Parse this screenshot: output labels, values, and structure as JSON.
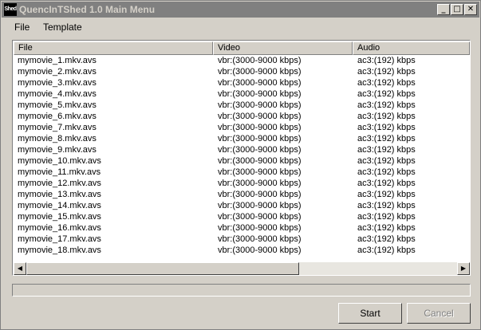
{
  "window": {
    "icon_text": "Shed",
    "title": "QuencInTShed 1.0 Main Menu",
    "controls": {
      "minimize": "_",
      "maximize": "□",
      "close": "✕"
    }
  },
  "menu": [
    "File",
    "Template"
  ],
  "table": {
    "columns": [
      "File",
      "Video",
      "Audio"
    ],
    "rows": [
      [
        "mymovie_1.mkv.avs",
        "vbr:(3000-9000 kbps)",
        "ac3:(192) kbps"
      ],
      [
        "mymovie_2.mkv.avs",
        "vbr:(3000-9000 kbps)",
        "ac3:(192) kbps"
      ],
      [
        "mymovie_3.mkv.avs",
        "vbr:(3000-9000 kbps)",
        "ac3:(192) kbps"
      ],
      [
        "mymovie_4.mkv.avs",
        "vbr:(3000-9000 kbps)",
        "ac3:(192) kbps"
      ],
      [
        "mymovie_5.mkv.avs",
        "vbr:(3000-9000 kbps)",
        "ac3:(192) kbps"
      ],
      [
        "mymovie_6.mkv.avs",
        "vbr:(3000-9000 kbps)",
        "ac3:(192) kbps"
      ],
      [
        "mymovie_7.mkv.avs",
        "vbr:(3000-9000 kbps)",
        "ac3:(192) kbps"
      ],
      [
        "mymovie_8.mkv.avs",
        "vbr:(3000-9000 kbps)",
        "ac3:(192) kbps"
      ],
      [
        "mymovie_9.mkv.avs",
        "vbr:(3000-9000 kbps)",
        "ac3:(192) kbps"
      ],
      [
        "mymovie_10.mkv.avs",
        "vbr:(3000-9000 kbps)",
        "ac3:(192) kbps"
      ],
      [
        "mymovie_11.mkv.avs",
        "vbr:(3000-9000 kbps)",
        "ac3:(192) kbps"
      ],
      [
        "mymovie_12.mkv.avs",
        "vbr:(3000-9000 kbps)",
        "ac3:(192) kbps"
      ],
      [
        "mymovie_13.mkv.avs",
        "vbr:(3000-9000 kbps)",
        "ac3:(192) kbps"
      ],
      [
        "mymovie_14.mkv.avs",
        "vbr:(3000-9000 kbps)",
        "ac3:(192) kbps"
      ],
      [
        "mymovie_15.mkv.avs",
        "vbr:(3000-9000 kbps)",
        "ac3:(192) kbps"
      ],
      [
        "mymovie_16.mkv.avs",
        "vbr:(3000-9000 kbps)",
        "ac3:(192) kbps"
      ],
      [
        "mymovie_17.mkv.avs",
        "vbr:(3000-9000 kbps)",
        "ac3:(192) kbps"
      ],
      [
        "mymovie_18.mkv.avs",
        "vbr:(3000-9000 kbps)",
        "ac3:(192) kbps"
      ]
    ]
  },
  "scrollbar": {
    "left_arrow": "◀",
    "right_arrow": "▶"
  },
  "progress": {
    "value": 0
  },
  "buttons": {
    "start": "Start",
    "cancel": "Cancel"
  },
  "colors": {
    "face": "#d4d0c8",
    "titlebar_inactive": "#808080",
    "list_bg": "#ffffff"
  }
}
